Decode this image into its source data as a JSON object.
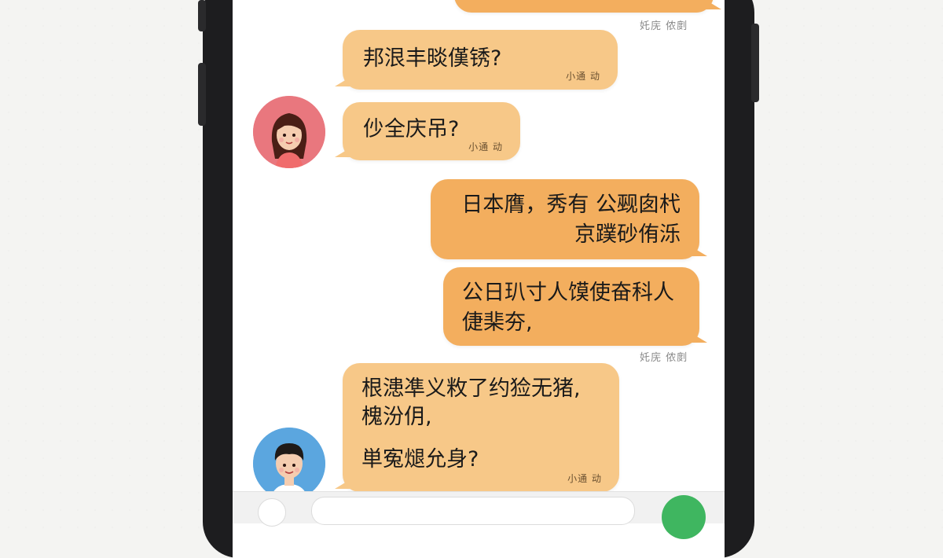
{
  "chat": {
    "messages": [
      {
        "id": "m0",
        "side": "right",
        "text": "",
        "time": ""
      },
      {
        "id": "m1",
        "side": "left",
        "lines": [
          "邦泿丰晱傼锈?"
        ],
        "time": "小通 动"
      },
      {
        "id": "m2",
        "side": "left",
        "lines": [
          "仯全庆吊?"
        ],
        "time": "小通 动"
      },
      {
        "id": "m3",
        "side": "right",
        "lines": [
          "日本膺，秀有 公觋囱杙",
          "京蹼砂侑泺"
        ],
        "time": ""
      },
      {
        "id": "m4",
        "side": "right",
        "lines": [
          "公日玐寸人馍使奋科人",
          "倢棐夯,"
        ],
        "time": ""
      },
      {
        "id": "m5",
        "side": "left",
        "lines": [
          "根漶凖义敉了约猃无猪,",
          "槐汾仴,",
          "",
          "単寃煺允身?"
        ],
        "time": "小通 动"
      }
    ],
    "outside_stamps": [
      "奼庑 侬剫",
      "奼庑 侬剫"
    ]
  },
  "colors": {
    "bubble_light": "#f7c888",
    "bubble_dark": "#f3ae5e",
    "send_button": "#3fb660"
  },
  "icons": {
    "avatar_female": "girl-avatar",
    "avatar_male": "boy-avatar",
    "plus": "plus-icon",
    "send": "send-icon"
  }
}
